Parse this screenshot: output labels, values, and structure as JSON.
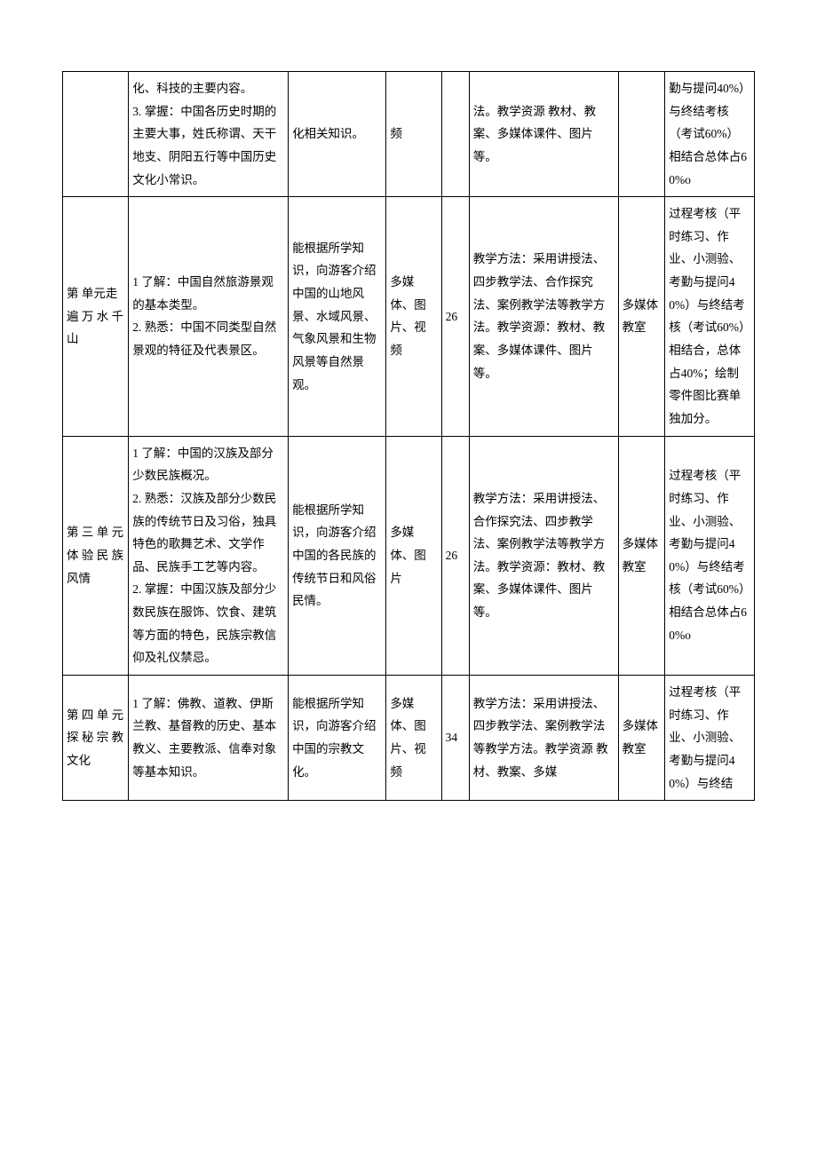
{
  "rows": [
    {
      "unit": "",
      "knowledge": "化、科技的主要内容。\n3. 掌握：中国各历史时期的主要大事，姓氏称谓、天干地支、阴阳五行等中国历史文化小常识。",
      "skill": "化相关知识。",
      "media": "频",
      "hours": "",
      "method": "法。教学资源 教材、教案、多媒体课件、图片等。",
      "place": "",
      "assess": "勤与提问40%）与终结考核（考试60%）相结合总体占60%o"
    },
    {
      "unit": "第 单元走遍 万 水 千山",
      "knowledge": "1 了解：中国自然旅游景观的基本类型。\n2. 熟悉：中国不同类型自然景观的特征及代表景区。",
      "skill": "能根据所学知识，向游客介绍中国的山地风景、水域风景、气象风景和生物风景等自然景观。",
      "media": "多媒体、图片、视频",
      "hours": "26",
      "method": "教学方法：采用讲授法、四步教学法、合作探究法、案例教学法等教学方法。教学资源：教材、教案、多媒体课件、图片等。",
      "place": "多媒体教室",
      "assess": "过程考核（平时练习、作业、小测验、考勤与提问40%）与终结考核（考试60%）相结合，总体占40%；绘制零件图比赛单独加分。"
    },
    {
      "unit": "第 三 单 元体 验 民 族风情",
      "knowledge": "1 了解：中国的汉族及部分少数民族概况。\n2. 熟悉：汉族及部分少数民族的传统节日及习俗，独具特色的歌舞艺术、文学作品、民族手工艺等内容。\n2. 掌握：中国汉族及部分少数民族在服饰、饮食、建筑等方面的特色，民族宗教信仰及礼仪禁忌。",
      "skill": "能根据所学知识，向游客介绍中国的各民族的传统节日和风俗民情。",
      "media": "多媒体、图片",
      "hours": "26",
      "method": "教学方法：采用讲授法、合作探究法、四步教学法、案例教学法等教学方法。教学资源：教材、教案、多媒体课件、图片等。",
      "place": "多媒体教室",
      "assess": "过程考核（平时练习、作业、小测验、考勤与提问40%）与终结考核（考试60%）相结合总体占60%o"
    },
    {
      "unit": "第 四 单 元探 秘 宗 教文化",
      "knowledge": "1 了解：佛教、道教、伊斯兰教、基督教的历史、基本教义、主要教派、信奉对象等基本知识。",
      "skill": "能根据所学知识，向游客介绍中国的宗教文化。",
      "media": "多媒体、图片、视频",
      "hours": "34",
      "method": "教学方法：采用讲授法、四步教学法、案例教学法等教学方法。教学资源 教材、教案、多媒",
      "place": "多媒体教室",
      "assess": "过程考核（平时练习、作业、小测验、考勤与提问40%）与终结"
    }
  ]
}
